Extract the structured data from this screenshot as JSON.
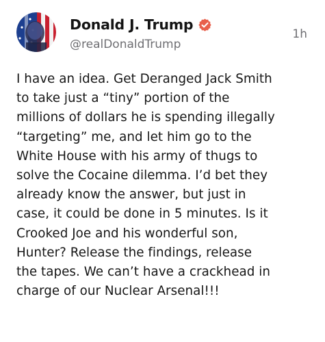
{
  "post": {
    "author": {
      "display_name": "Donald J. Trump",
      "handle": "@realDonaldTrump",
      "verified_icon": "verified-badge-icon",
      "avatar": "profile-avatar"
    },
    "timestamp": "1h",
    "text": "I have an idea. Get Deranged Jack Smith\nto take just a “tiny” portion of the\nmillions of dollars he is spending illegally\n“targeting” me, and let him go to the\nWhite House with his army of thugs to\nsolve the Cocaine dilemma. I’d bet they\nalready know the answer, but just in\ncase, it could be done in 5 minutes. Is it\nCrooked Joe and his wonderful son,\nHunter? Release the findings, release\nthe tapes. We can’t have a crackhead in\ncharge of our Nuclear Arsenal!!!"
  },
  "colors": {
    "name_text": "#141414",
    "secondary_text": "#6e6e72",
    "body_text": "#161616",
    "verified_badge": "#e8604c",
    "background": "#ffffff"
  }
}
